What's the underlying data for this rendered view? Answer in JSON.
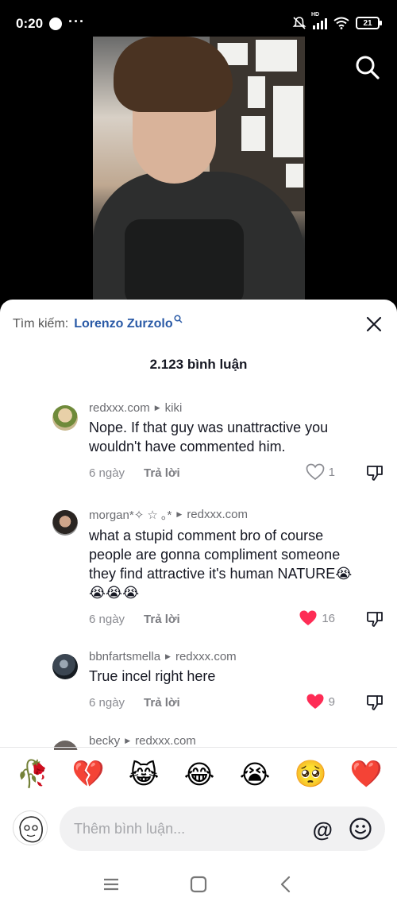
{
  "status_bar": {
    "time": "0:20",
    "dots": "···",
    "hd_label": "HD",
    "battery": "21"
  },
  "sheet": {
    "search_label": "Tìm kiếm:",
    "search_term": "Lorenzo Zurzolo",
    "comment_count": "2.123 bình luận"
  },
  "comments": [
    {
      "user": "redxxx.com",
      "reply_to": "kiki",
      "text_line1": "Nope. If that guy was unattractive you",
      "text_line2": "wouldn't have commented him.",
      "age": "6 ngày",
      "reply": "Trả lời",
      "likes": "1",
      "liked": false
    },
    {
      "user": "morgan*✧ ☆ ｡*",
      "reply_to": "redxxx.com",
      "text_line1": "what a stupid comment bro of course",
      "text_line2": "people are gonna compliment someone",
      "text_line3": "they find attractive it's human NATURE😭",
      "text_line4": "😭😭😭",
      "age": "6 ngày",
      "reply": "Trả lời",
      "likes": "16",
      "liked": true
    },
    {
      "user": "bbnfartsmella",
      "reply_to": "redxxx.com",
      "text_line1": "True incel right here",
      "age": "6 ngày",
      "reply": "Trả lời",
      "likes": "9",
      "liked": true
    },
    {
      "user": "becky",
      "reply_to": "redxxx.com"
    }
  ],
  "emojis": [
    "🥀",
    "💔",
    "😹",
    "😂",
    "😭",
    "🥺",
    "❤️"
  ],
  "input": {
    "placeholder": "Thêm bình luận...",
    "at_symbol": "@"
  },
  "colors": {
    "accent_blue": "#2a5aa6",
    "like_red": "#fe2c55",
    "text_dark": "#161823",
    "text_muted": "#8a8b91"
  }
}
